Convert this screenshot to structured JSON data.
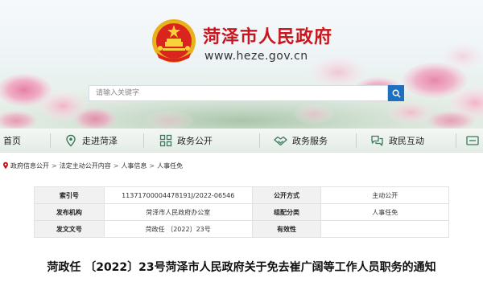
{
  "header": {
    "site_title": "菏泽市人民政府",
    "site_url": "www.heze.gov.cn",
    "search_placeholder": "请输入关键字"
  },
  "nav": {
    "items": [
      {
        "label": "首页",
        "icon": "home-icon"
      },
      {
        "label": "走进菏泽",
        "icon": "location-pin-icon"
      },
      {
        "label": "政务公开",
        "icon": "grid-icon"
      },
      {
        "label": "政务服务",
        "icon": "handshake-icon"
      },
      {
        "label": "政民互动",
        "icon": "chat-bubbles-icon"
      }
    ]
  },
  "breadcrumb": [
    "政府信息公开",
    "法定主动公开内容",
    "人事信息",
    "人事任免"
  ],
  "info_table": {
    "rows": [
      {
        "k1": "索引号",
        "v1": "11371700004478191J/2022-06546",
        "k2": "公开方式",
        "v2": "主动公开"
      },
      {
        "k1": "发布机构",
        "v1": "菏泽市人民政府办公室",
        "k2": "组配分类",
        "v2": "人事任免"
      },
      {
        "k1": "发文文号",
        "v1": "菏政任 〔2022〕23号",
        "k2": "有效性",
        "v2": ""
      }
    ]
  },
  "document": {
    "title": "菏政任 〔2022〕23号菏泽市人民政府关于免去崔广阔等工作人员职务的通知"
  },
  "colors": {
    "brand_red": "#c8161e",
    "search_button": "#1e6fc0",
    "nav_icon": "#3a7a5a"
  }
}
